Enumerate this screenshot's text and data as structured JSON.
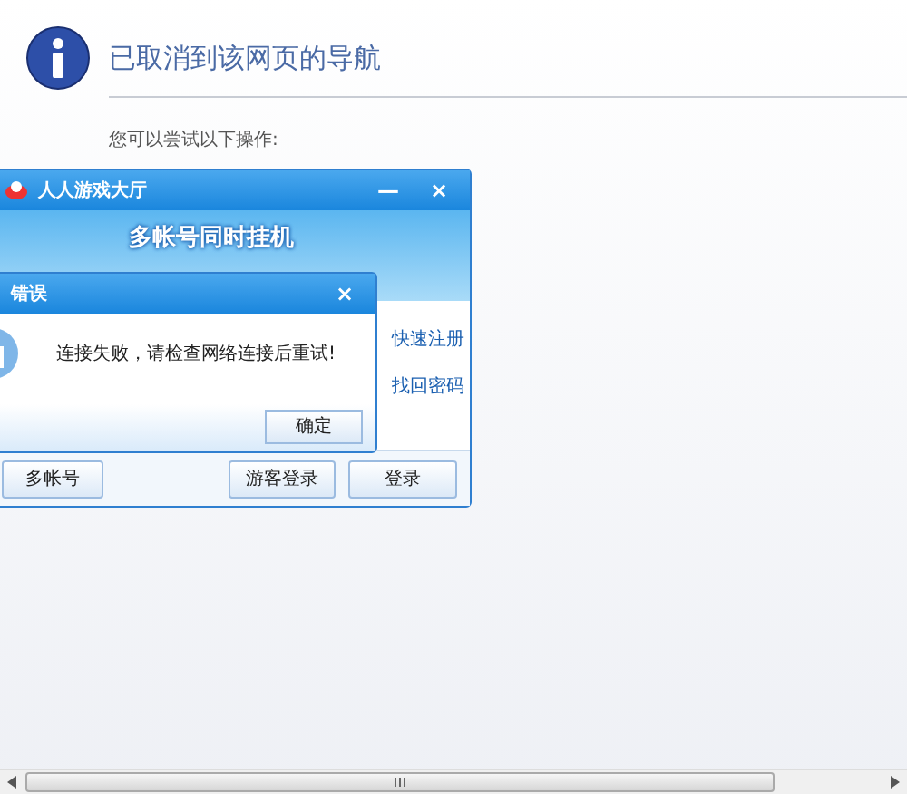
{
  "page": {
    "title": "已取消到该网页的导航",
    "subtitle": "您可以尝试以下操作:"
  },
  "app_window": {
    "title": "人人游戏大厅",
    "minimize": "—",
    "close": "×",
    "banner_text": "多帐号同时挂机",
    "links": [
      "快速注册",
      "找回密码"
    ],
    "buttons": [
      "多帐号",
      "游客登录",
      "登录"
    ]
  },
  "error_dialog": {
    "title": "错误",
    "close": "×",
    "message": "连接失败，请检查网络连接后重试!",
    "button": "确定"
  }
}
